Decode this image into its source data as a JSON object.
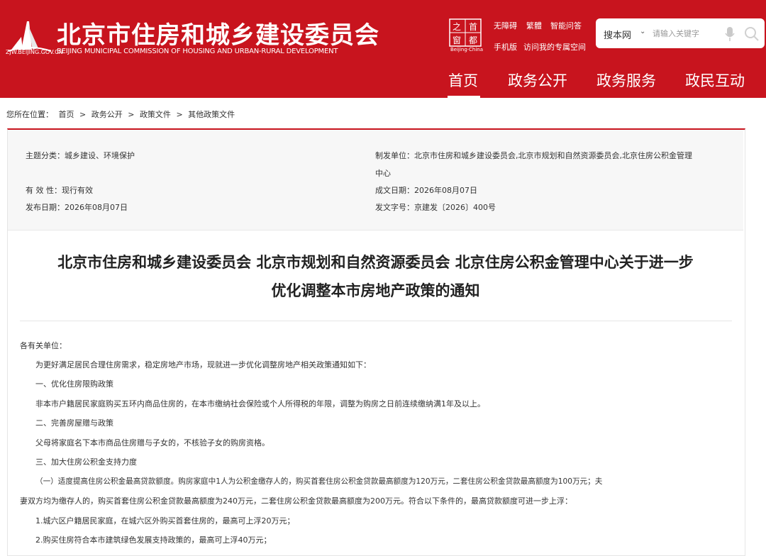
{
  "header": {
    "site_url": "ZJW.BEIJING.GOV.CN",
    "site_title": "北京市住房和城乡建设委员会",
    "site_subtitle": "BEIJING MUNICIPAL COMMISSION OF HOUSING AND URBAN-RURAL DEVELOPMENT",
    "capital_chars": [
      "首",
      "都",
      "之",
      "窗"
    ],
    "capital_text": "Beijing·China",
    "links": [
      "无障碍",
      "繁體",
      "智能问答",
      "手机版",
      "访问我的专属空间"
    ],
    "search": {
      "scope": "搜本网",
      "placeholder": "请输入关键字"
    },
    "nav": [
      "首页",
      "政务公开",
      "政务服务",
      "政民互动"
    ],
    "active_nav": "首页"
  },
  "breadcrumb": {
    "prefix": "您所在位置：",
    "items": [
      "首页",
      "政务公开",
      "政策文件",
      "其他政策文件"
    ],
    "separator": ">"
  },
  "meta": {
    "topic": "主题分类：城乡建设、环境保护",
    "validity": "有 效 性：现行有效",
    "publish_date": "发布日期：2026年08月07日",
    "issuer_line1": "制发单位：北京市住房和城乡建设委员会,北京市规划和自然资源委员会,北京住房公积金管理",
    "issuer_line2": "中心",
    "written_date": "成文日期：2026年08月07日",
    "doc_number": "发文字号：京建发〔2026〕400号"
  },
  "document": {
    "title_line1": "北京市住房和城乡建设委员会 北京市规划和自然资源委员会 北京住房公积金管理中心关于进一步",
    "title_line2": "优化调整本市房地产政策的通知",
    "paragraphs": [
      "各有关单位：",
      "为更好满足居民合理住房需求，稳定房地产市场，现就进一步优化调整房地产相关政策通知如下：",
      "一、优化住房限购政策",
      "非本市户籍居民家庭购买五环内商品住房的，在本市缴纳社会保险或个人所得税的年限，调整为购房之日前连续缴纳满1年及以上。",
      "二、完善房屋赠与政策",
      "父母将家庭名下本市商品住房赠与子女的，不核验子女的购房资格。",
      "三、加大住房公积金支持力度",
      "（一）适度提高住房公积金最高贷款额度。购房家庭中1人为公积金缴存人的，购买首套住房公积金贷款最高额度为120万元，二套住房公积金贷款最高额度为100万元；夫",
      "妻双方均为缴存人的，购买首套住房公积金贷款最高额度为240万元，二套住房公积金贷款最高额度为200万元。符合以下条件的，最高贷款额度可进一步上浮：",
      "1.城六区户籍居民家庭，在城六区外购买首套住房的，最高可上浮20万元；",
      "2.购买住房符合本市建筑绿色发展支持政策的，最高可上浮40万元；"
    ]
  },
  "colors": {
    "brand_red": "#c8141e"
  }
}
